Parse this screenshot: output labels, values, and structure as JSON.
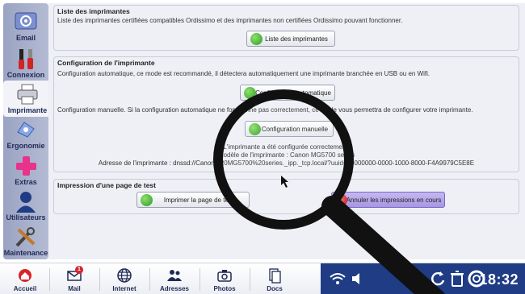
{
  "sidebar": {
    "items": [
      {
        "label": "Email",
        "icon": "email-icon"
      },
      {
        "label": "Connexion",
        "icon": "tools-icon"
      },
      {
        "label": "Imprimante",
        "icon": "printer-icon",
        "active": true
      },
      {
        "label": "Ergonomie",
        "icon": "ergonomie-icon"
      },
      {
        "label": "Extras",
        "icon": "plus-icon"
      },
      {
        "label": "Utilisateurs",
        "icon": "user-icon"
      },
      {
        "label": "Maintenance",
        "icon": "wrench-icon"
      }
    ]
  },
  "printers_list": {
    "title": "Liste des imprimantes",
    "description": "Liste des imprimantes certifiées compatibles Ordissimo et des imprimantes non certifiées Ordissimo pouvant fonctionner.",
    "button_label": "Liste des imprimantes"
  },
  "configuration": {
    "title": "Configuration de l'imprimante",
    "auto_description": "Configuration automatique, ce mode est recommandé, il détectera automatiquement une imprimante branchée en USB ou en Wifi.",
    "auto_button_label": "Configuration automatique",
    "manual_description": "Configuration manuelle. Si la configuration automatique ne fonctionne pas correctement, ce mode vous permettra de configurer votre imprimante.",
    "manual_button_label": "Configuration manuelle",
    "status_line1": "L'imprimante a été configurée correctement.",
    "status_line2": "Modèle de l'imprimante : Canon MG5700 series",
    "status_line3": "Adresse de l'imprimante : dnssd://Canon%20MG5700%20series._ipp._tcp.local/?uuid=00000000-0000-1000-8000-F4A9979C5E8E"
  },
  "test_print": {
    "title": "Impression d'une page de test",
    "print_button_label": "Imprimer la page de test",
    "cancel_button_label": "Annuler les impressions en cours"
  },
  "taskbar": {
    "items": [
      {
        "label": "Accueil",
        "icon": "home-icon"
      },
      {
        "label": "Mail",
        "icon": "mail-icon",
        "badge": "1"
      },
      {
        "label": "Internet",
        "icon": "globe-icon"
      },
      {
        "label": "Adresses",
        "icon": "contacts-icon"
      },
      {
        "label": "Photos",
        "icon": "camera-icon"
      },
      {
        "label": "Docs",
        "icon": "docs-icon"
      }
    ],
    "clock": "18:32"
  },
  "colors": {
    "accent": "#1f3c85",
    "sidebar": "#a7afca",
    "ok": "#2c9a25",
    "cancel": "#a796e2"
  }
}
